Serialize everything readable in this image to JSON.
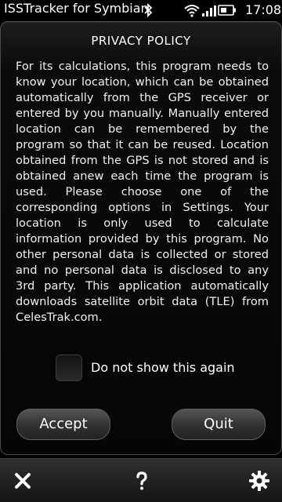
{
  "status_bar": {
    "app_title": "ISSTracker for Symbian",
    "time": "17:08"
  },
  "dialog": {
    "title": "PRIVACY POLICY",
    "body": "For its calculations, this program needs to know your location, which can be obtained automatically from the GPS receiver or entered by you manually. Manually entered location can be remembered by the program so that it can be reused. Location obtained from the GPS is not stored and is obtained anew each time the program is used. Please choose one of the corresponding options in Settings. Your location is only used to calculate information provided by this program. No other personal data is collected or stored and no personal data is disclosed to any 3rd party. This application automatically downloads satellite orbit data (TLE) from CelesTrak.com.",
    "checkbox_label": "Do not show this again",
    "checkbox_checked": false,
    "accept_label": "Accept",
    "quit_label": "Quit"
  },
  "toolbar": {
    "icons": [
      "close-icon",
      "help-icon",
      "gear-icon"
    ]
  }
}
